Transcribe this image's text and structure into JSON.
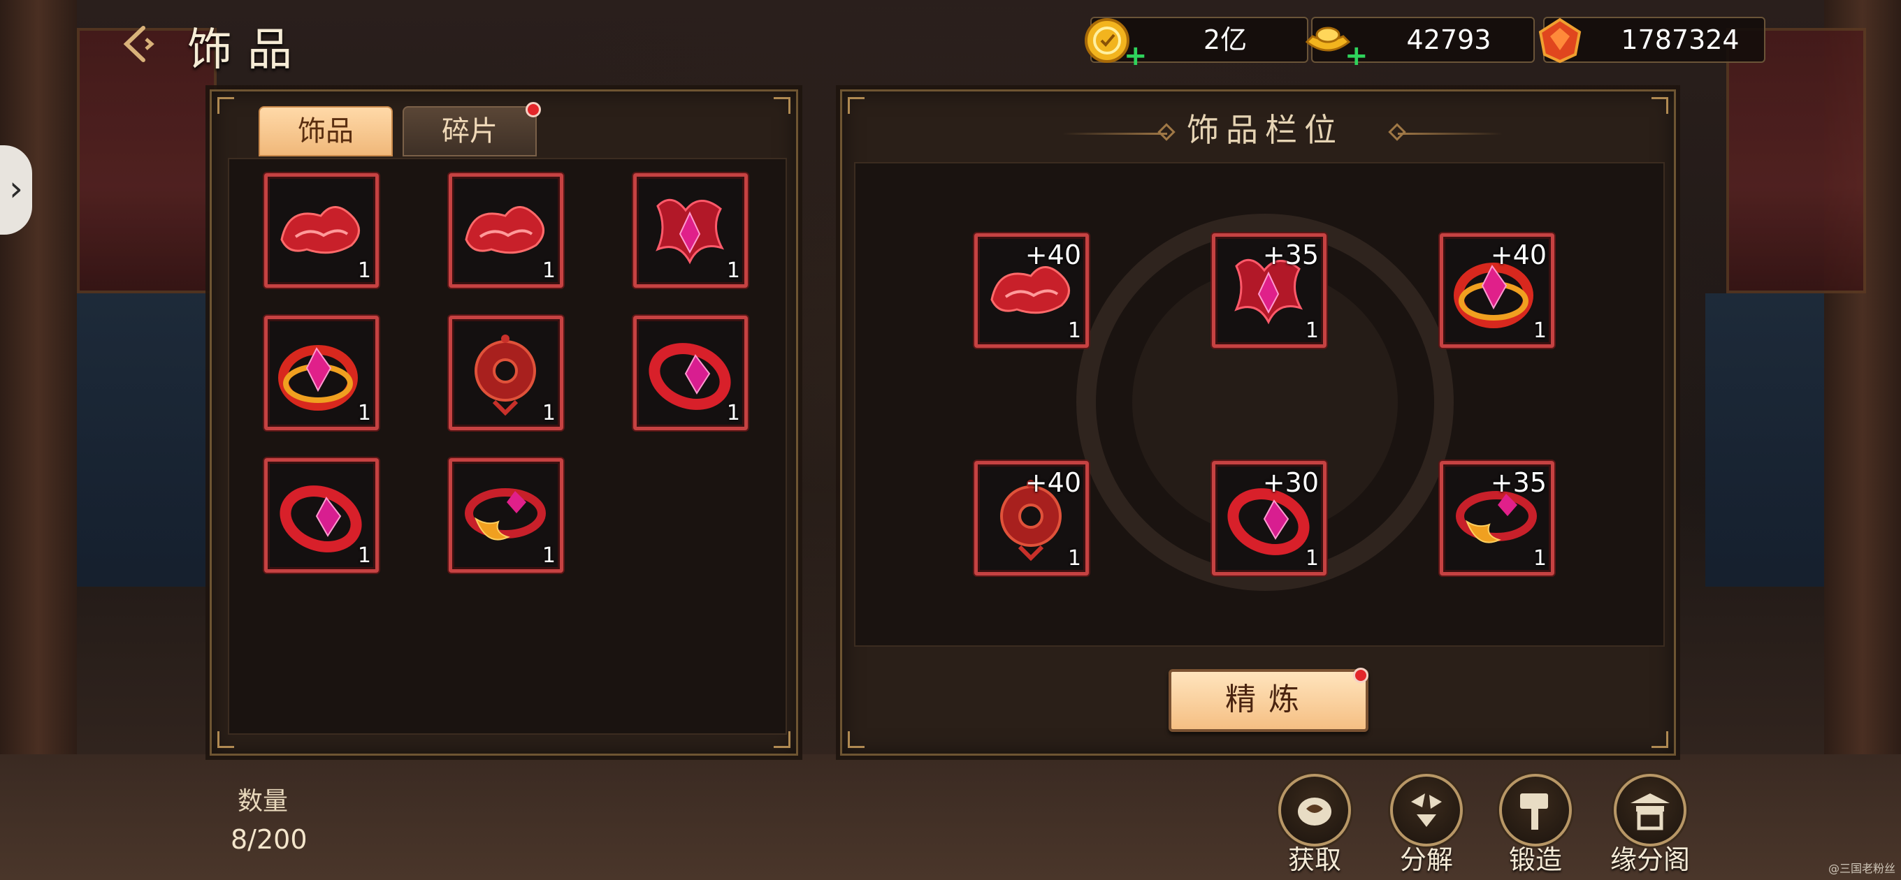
{
  "header": {
    "back_icon": "back-arrow-icon",
    "title": "饰品"
  },
  "currencies": [
    {
      "name": "coin-icon",
      "value": "2亿",
      "has_plus": true
    },
    {
      "name": "ingot-icon",
      "value": "42793",
      "has_plus": true
    },
    {
      "name": "gem-icon",
      "value": "1787324",
      "has_plus": false
    }
  ],
  "tabs": [
    {
      "label": "饰品",
      "active": true
    },
    {
      "label": "碎片",
      "active": false,
      "has_badge": true
    }
  ],
  "inventory": [
    {
      "icon": "red-cloud-charm-icon",
      "qty": "1"
    },
    {
      "icon": "red-cloud-charm-icon",
      "qty": "1"
    },
    {
      "icon": "red-crystal-pendant-icon",
      "qty": "1"
    },
    {
      "icon": "gold-crystal-ring-icon",
      "qty": "1"
    },
    {
      "icon": "red-coin-pendant-icon",
      "qty": "1"
    },
    {
      "icon": "red-crystal-ring-icon",
      "qty": "1"
    },
    {
      "icon": "red-crystal-ring-icon",
      "qty": "1"
    },
    {
      "icon": "gold-flame-ring-icon",
      "qty": "1"
    }
  ],
  "slots_panel": {
    "title": "饰品栏位",
    "slots": [
      {
        "icon": "red-cloud-charm-icon",
        "level": "+40",
        "qty": "1"
      },
      {
        "icon": "red-crystal-pendant-icon",
        "level": "+35",
        "qty": "1"
      },
      {
        "icon": "gold-crystal-ring-icon",
        "level": "+40",
        "qty": "1"
      },
      {
        "icon": "red-coin-pendant-icon",
        "level": "+40",
        "qty": "1"
      },
      {
        "icon": "red-crystal-ring-icon",
        "level": "+30",
        "qty": "1"
      },
      {
        "icon": "gold-flame-ring-icon",
        "level": "+35",
        "qty": "1"
      }
    ],
    "refine_label": "精炼"
  },
  "count": {
    "label": "数量",
    "value": "8/200"
  },
  "actions": [
    {
      "label": "获取",
      "icon": "obtain-icon"
    },
    {
      "label": "分解",
      "icon": "decompose-icon"
    },
    {
      "label": "锻造",
      "icon": "forge-hammer-icon"
    },
    {
      "label": "缘分阁",
      "icon": "pavilion-icon"
    }
  ],
  "watermark": "@三国老粉丝",
  "colors": {
    "slot_border": "#c64242",
    "tab_active": "#f0b87a",
    "badge": "#e3262a",
    "plus": "#2fd35c"
  }
}
